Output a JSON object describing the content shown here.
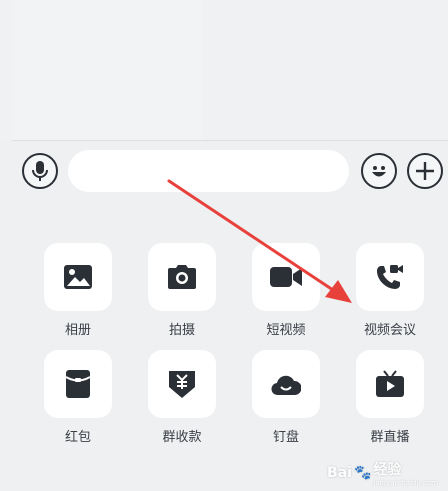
{
  "input_bar": {
    "voice_icon": "microphone-icon",
    "text_value": "",
    "emoji_icon": "smiley-icon",
    "more_icon": "plus-icon"
  },
  "actions": [
    {
      "label": "相册",
      "icon": "image-icon"
    },
    {
      "label": "拍摄",
      "icon": "camera-icon"
    },
    {
      "label": "短视频",
      "icon": "video-camera-icon"
    },
    {
      "label": "视频会议",
      "icon": "video-call-icon"
    },
    {
      "label": "红包",
      "icon": "red-packet-icon"
    },
    {
      "label": "群收款",
      "icon": "group-collect-icon"
    },
    {
      "label": "钉盘",
      "icon": "cloud-drive-icon"
    },
    {
      "label": "群直播",
      "icon": "live-tv-icon"
    }
  ],
  "annotation": {
    "arrow_color": "#e8413b"
  },
  "watermark": {
    "text": "Bai",
    "text2": "经验",
    "sub": "jingyan.baidu.com"
  },
  "colors": {
    "icon": "#2b2f36",
    "tile": "#ffffff",
    "background": "#eef0f2"
  }
}
